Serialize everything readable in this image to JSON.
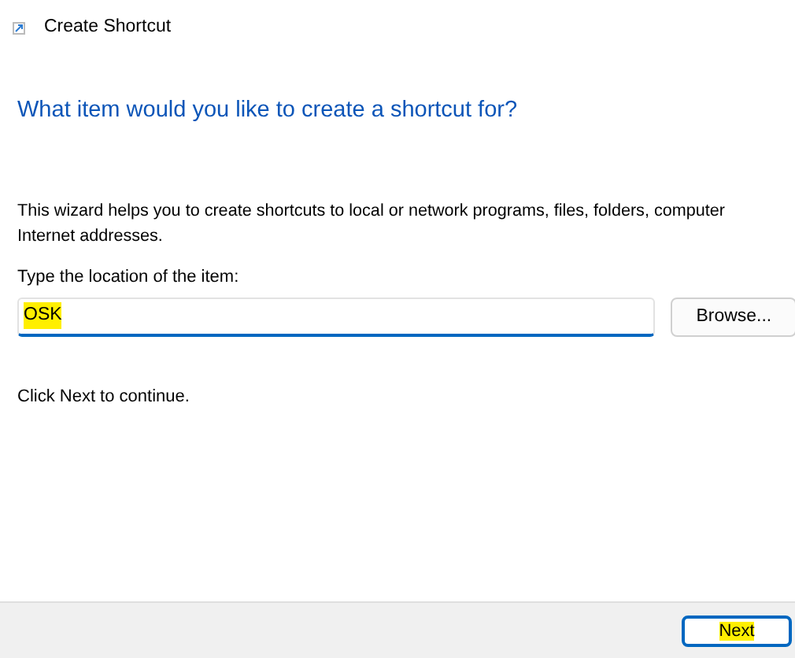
{
  "window": {
    "title": "Create Shortcut"
  },
  "heading": "What item would you like to create a shortcut for?",
  "description_lines": [
    "This wizard helps you to create shortcuts to local or network programs, files, folders, computer",
    "Internet addresses."
  ],
  "location": {
    "label": "Type the location of the item:",
    "value": "OSK",
    "highlighted": true
  },
  "browse_button": "Browse...",
  "hint": "Click Next to continue.",
  "footer_buttons": [
    {
      "label": "Next",
      "focused": true,
      "highlighted": true
    }
  ]
}
